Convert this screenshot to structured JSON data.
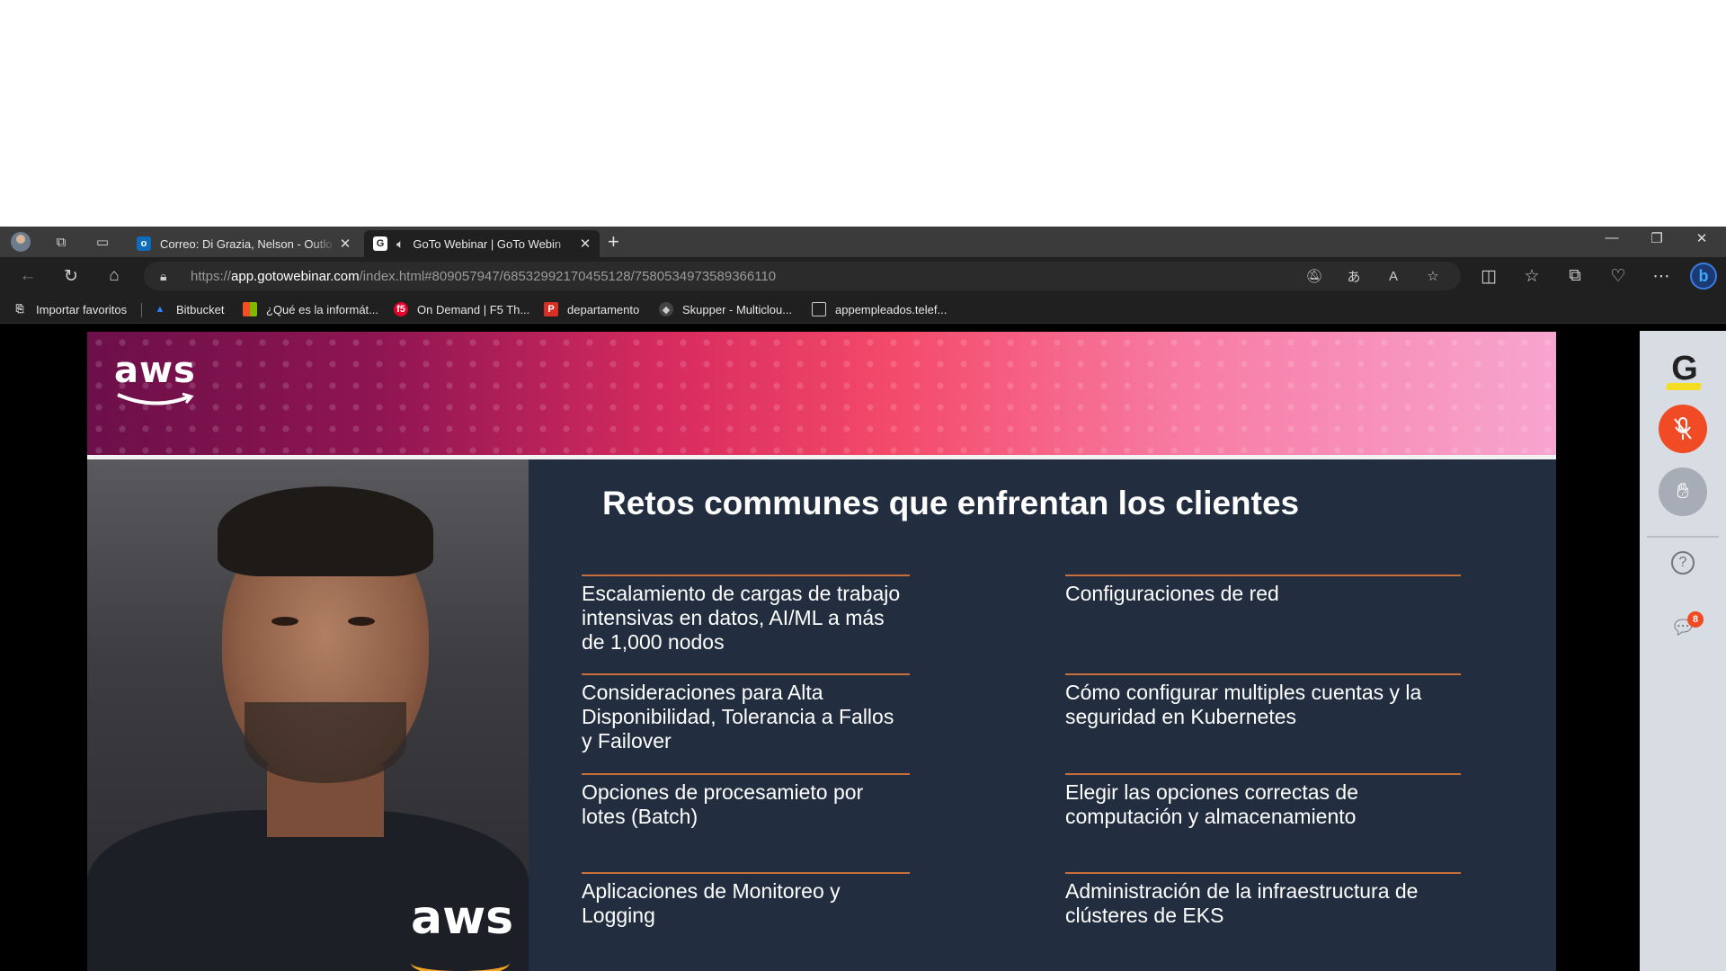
{
  "browser": {
    "tabs": [
      {
        "title": "Correo: Di Grazia, Nelson - Outlo",
        "favicon": "outlook-icon"
      },
      {
        "title": "GoTo Webinar | GoTo Webin",
        "favicon": "goto-icon",
        "audio": true
      }
    ],
    "url_scheme": "https://",
    "url_host": "app.gotowebinar.com",
    "url_path": "/index.html#809057947/6853299217045512​8/7580534973589366110",
    "bookmarks": [
      {
        "label": "Importar favoritos",
        "icon": "import-icon"
      },
      {
        "label": "Bitbucket",
        "icon": "bitbucket-icon"
      },
      {
        "label": "¿Qué es la informát...",
        "icon": "microsoft-icon"
      },
      {
        "label": "On Demand | F5 Th...",
        "icon": "f5-icon"
      },
      {
        "label": "departamento",
        "icon": "pdf-icon"
      },
      {
        "label": "Skupper - Multiclou...",
        "icon": "skupper-icon"
      },
      {
        "label": "appempleados.telef...",
        "icon": "page-icon"
      }
    ]
  },
  "slide": {
    "logo": "aws",
    "title": "Retos communes que enfrentan los clientes",
    "left_items": [
      "Escalamiento de cargas de trabajo intensivas en datos, AI/ML a más de 1,000 nodos",
      "Consideraciones para Alta Disponibilidad, Tolerancia a Fallos y Failover",
      "Opciones de procesamieto por lotes (Batch)",
      "Aplicaciones de Monitoreo y Logging"
    ],
    "right_items": [
      "Configuraciones de red",
      "Cómo configurar multiples cuentas y la seguridad en Kubernetes",
      "Elegir las opciones correctas de computación y almacenamiento",
      "Administración de la infraestructura de clústeres de EKS"
    ],
    "shirt_logo": "aws"
  },
  "side_panel": {
    "logo": "G",
    "chat_badge": "8",
    "colors": {
      "mic": "#f04b24",
      "logo_bar": "#f4dd22"
    }
  },
  "colors": {
    "accent_line": "#c8703c",
    "slide_bg": "#222e40"
  }
}
